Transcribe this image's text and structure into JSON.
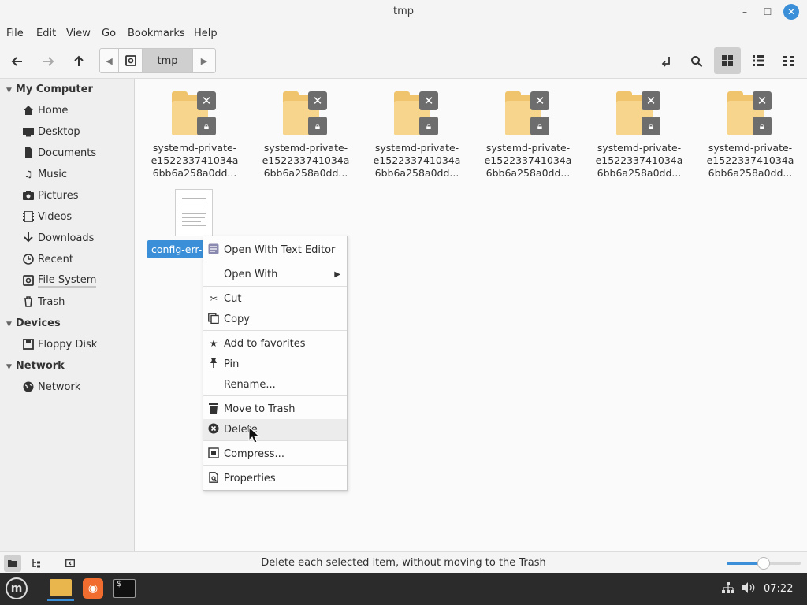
{
  "window": {
    "title": "tmp",
    "minimize_glyph": "–",
    "maximize_glyph": "☐",
    "close_glyph": "✕"
  },
  "menubar": {
    "items": [
      "File",
      "Edit",
      "View",
      "Go",
      "Bookmarks",
      "Help"
    ]
  },
  "toolbar": {
    "back_icon": "arrow-left-icon",
    "forward_icon": "arrow-right-icon",
    "up_icon": "arrow-up-icon",
    "path_current": "tmp",
    "toggle_location_icon": "location-icon",
    "search_icon": "search-icon",
    "icon_view_icon": "grid-icon",
    "list_view_icon": "list-icon",
    "compact_view_icon": "compact-icon"
  },
  "sidebar": {
    "sections": [
      {
        "title": "My Computer",
        "items": [
          {
            "label": "Home",
            "icon": "home-icon"
          },
          {
            "label": "Desktop",
            "icon": "desktop-icon"
          },
          {
            "label": "Documents",
            "icon": "documents-icon"
          },
          {
            "label": "Music",
            "icon": "music-icon"
          },
          {
            "label": "Pictures",
            "icon": "pictures-icon"
          },
          {
            "label": "Videos",
            "icon": "videos-icon"
          },
          {
            "label": "Downloads",
            "icon": "downloads-icon"
          },
          {
            "label": "Recent",
            "icon": "recent-icon"
          },
          {
            "label": "File System",
            "icon": "filesystem-icon"
          },
          {
            "label": "Trash",
            "icon": "trash-icon"
          }
        ]
      },
      {
        "title": "Devices",
        "items": [
          {
            "label": "Floppy Disk",
            "icon": "floppy-icon"
          }
        ]
      },
      {
        "title": "Network",
        "items": [
          {
            "label": "Network",
            "icon": "network-icon"
          }
        ]
      }
    ]
  },
  "files": [
    {
      "line1": "systemd-private-",
      "line2": "e152233741034a",
      "line3": "6bb6a258a0dd..."
    },
    {
      "line1": "systemd-private-",
      "line2": "e152233741034a",
      "line3": "6bb6a258a0dd..."
    },
    {
      "line1": "systemd-private-",
      "line2": "e152233741034a",
      "line3": "6bb6a258a0dd..."
    },
    {
      "line1": "systemd-private-",
      "line2": "e152233741034a",
      "line3": "6bb6a258a0dd..."
    },
    {
      "line1": "systemd-private-",
      "line2": "e152233741034a",
      "line3": "6bb6a258a0dd..."
    },
    {
      "line1": "systemd-private-",
      "line2": "e152233741034a",
      "line3": "6bb6a258a0dd..."
    }
  ],
  "selected_file": {
    "label": "config-err-"
  },
  "context_menu": {
    "items": [
      {
        "label": "Open With Text Editor",
        "icon": "text-editor-icon"
      },
      {
        "label": "Open With",
        "icon": "",
        "submenu": true
      },
      {
        "label": "Cut",
        "icon": "scissors-icon"
      },
      {
        "label": "Copy",
        "icon": "copy-icon"
      },
      {
        "label": "Add to favorites",
        "icon": "star-icon"
      },
      {
        "label": "Pin",
        "icon": "pin-icon"
      },
      {
        "label": "Rename...",
        "icon": ""
      },
      {
        "label": "Move to Trash",
        "icon": "trash-icon"
      },
      {
        "label": "Delete",
        "icon": "delete-icon",
        "highlighted": true
      },
      {
        "label": "Compress...",
        "icon": "compress-icon"
      },
      {
        "label": "Properties",
        "icon": "properties-icon"
      }
    ]
  },
  "statusbar": {
    "text": "Delete each selected item, without moving to the Trash",
    "zoom_level": 0.5
  },
  "taskbar": {
    "clock": "07:22",
    "accent_color": "#3a8fd8"
  }
}
